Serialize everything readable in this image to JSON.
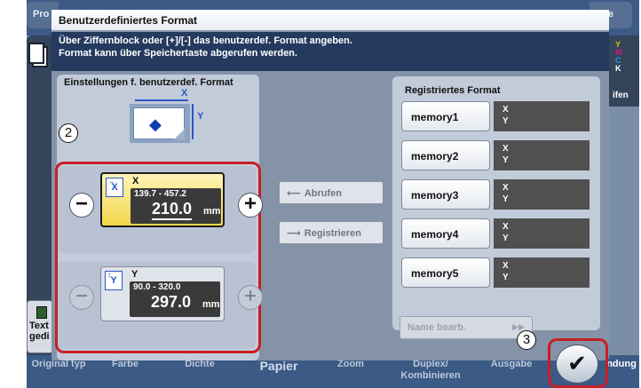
{
  "background": {
    "left_tab": "Pro",
    "right_tab": "iste",
    "right_label": "ifen",
    "ymck": [
      "Y",
      "M",
      "C",
      "K"
    ],
    "left_button_label": "Text gedi",
    "bottom_tabs": [
      "Original typ",
      "Farbe",
      "Dichte",
      "Papier",
      "Zoom",
      "Duplex/ Kombinieren",
      "Ausgabe",
      "ndung"
    ]
  },
  "dialog": {
    "title": "Benutzerdefiniertes Format",
    "instruction_line1": "Über Ziffernblock oder [+]/[-] das benutzerdef. Format angeben.",
    "instruction_line2": "Format kann über Speichertaste abgerufen werden."
  },
  "settings": {
    "title": "Einstellungen f. benutzerdef. Format",
    "diagram_x": "X",
    "diagram_y": "Y",
    "x": {
      "label": "X",
      "range": "139.7 - 457.2",
      "value": "210.0",
      "unit": "mm",
      "minus": "−",
      "plus": "+"
    },
    "y": {
      "label": "Y",
      "range": "90.0 - 320.0",
      "value": "297.0",
      "unit": "mm",
      "minus": "−",
      "plus": "+"
    }
  },
  "actions": {
    "recall_label": "Abrufen",
    "register_label": "Registrieren"
  },
  "registered": {
    "title": "Registriertes Format",
    "items": [
      {
        "label": "memory1",
        "x": "X",
        "y": "Y"
      },
      {
        "label": "memory2",
        "x": "X",
        "y": "Y"
      },
      {
        "label": "memory3",
        "x": "X",
        "y": "Y"
      },
      {
        "label": "memory4",
        "x": "X",
        "y": "Y"
      },
      {
        "label": "memory5",
        "x": "X",
        "y": "Y"
      }
    ],
    "name_edit": "Name bearb."
  },
  "callouts": {
    "two": "2",
    "three": "3"
  },
  "ok": "✔",
  "colors": {
    "highlight": "#c81e27",
    "active_field": "#f3d64a",
    "instruction_bg": "#243a5e"
  }
}
